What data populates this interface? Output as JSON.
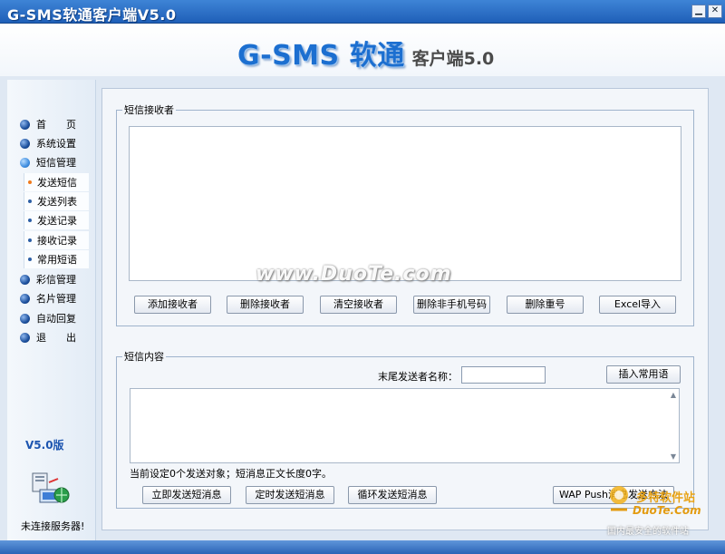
{
  "window": {
    "title": "G-SMS软通客户端V5.0",
    "min_glyph": "▁",
    "close_glyph": "✕"
  },
  "banner": {
    "brand": "G-SMS 软通",
    "subtitle": "客户端5.0"
  },
  "sidebar": {
    "items": [
      {
        "label": "首　　页"
      },
      {
        "label": "系统设置"
      },
      {
        "label": "短信管理"
      },
      {
        "label": "彩信管理"
      },
      {
        "label": "名片管理"
      },
      {
        "label": "自动回复"
      },
      {
        "label": "退　　出"
      }
    ],
    "sub_items": [
      {
        "label": "发送短信"
      },
      {
        "label": "发送列表"
      },
      {
        "label": "发送记录"
      },
      {
        "label": "接收记录"
      },
      {
        "label": "常用短语"
      }
    ],
    "version": "V5.0版",
    "status": "未连接服务器!"
  },
  "recipients": {
    "legend": "短信接收者",
    "buttons": {
      "add": "添加接收者",
      "delete": "删除接收者",
      "clear": "清空接收者",
      "delete_non_mobile": "删除非手机号码",
      "delete_duplicate": "删除重号",
      "excel_import": "Excel导入"
    }
  },
  "message": {
    "legend": "短信内容",
    "sender_label": "末尾发送者名称：",
    "sender_value": "",
    "insert_phrase": "插入常用语",
    "info": "当前设定0个发送对象；短消息正文长度0字。",
    "buttons": {
      "send_now": "立即发送短消息",
      "send_scheduled": "定时发送短消息",
      "send_loop": "循环发送短消息",
      "wap_push": "WAP Push消息发送方法"
    }
  },
  "watermarks": {
    "center": "www.DuoTe.com",
    "corner_1": "多特软件站",
    "corner_2": "DuoTe.Com",
    "corner_3": "国内最安全的软件站"
  }
}
